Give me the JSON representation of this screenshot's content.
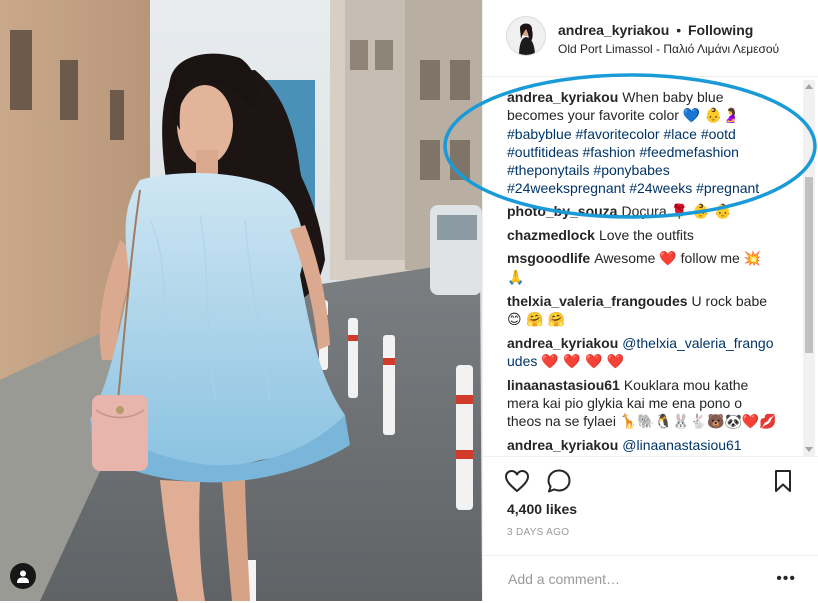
{
  "post": {
    "author": "andrea_kyriakou",
    "separator": "•",
    "follow_status": "Following",
    "location": "Old Port Limassol - Παλιό Λιμάνι Λεμεσού",
    "caption": {
      "user": "andrea_kyriakou",
      "text": "When baby blue becomes your favorite color",
      "emojis": "💙 👶🤰",
      "hashtags": [
        "#babyblue",
        "#favoritecolor",
        "#lace",
        "#ootd",
        "#outfitideas",
        "#fashion",
        "#feedmefashion",
        "#theponytails",
        "#ponybabes",
        "#24weekspregnant",
        "#24weeks",
        "#pregnant"
      ]
    },
    "comments": [
      {
        "user": "photo_by_souza",
        "text": "Doçura",
        "emojis": "🌹 👶 👶"
      },
      {
        "user": "chazmedlock",
        "text": "Love the outfits",
        "emojis": ""
      },
      {
        "user": "msgooodlife",
        "text": "Awesome",
        "emojis_mid": "❤️",
        "text2": "follow me",
        "emojis": "💥 🙏"
      },
      {
        "user": "thelxia_valeria_frangoudes",
        "text": "U rock babe",
        "emojis": "😊 🤗 🤗"
      },
      {
        "user": "andrea_kyriakou",
        "mention": "@thelxia_valeria_frangoudes",
        "emojis": "❤️ ❤️ ❤️ ❤️"
      },
      {
        "user": "linaanastasiou61",
        "text": "Kouklara mou kathe mera kai pio glykia kai me ena pono o theos na se fylaei",
        "emojis": "🦒🐘🐧🐰🐇🐻🐼❤️💋"
      },
      {
        "user": "andrea_kyriakou",
        "mention": "@linaanastasiou61",
        "emojis": ""
      }
    ],
    "likes": "4,400 likes",
    "timestamp": "3 DAYS AGO",
    "comment_placeholder": "Add a comment…",
    "more_options": "•••"
  },
  "icons": {
    "like": "heart-outline-icon",
    "comment": "speech-bubble-icon",
    "save": "bookmark-icon",
    "user_tag": "person-icon"
  },
  "colors": {
    "annotation": "#1a9bd7",
    "hashtag": "#003569",
    "heart": "#e0245e",
    "blue_heart": "#1da1f2"
  }
}
